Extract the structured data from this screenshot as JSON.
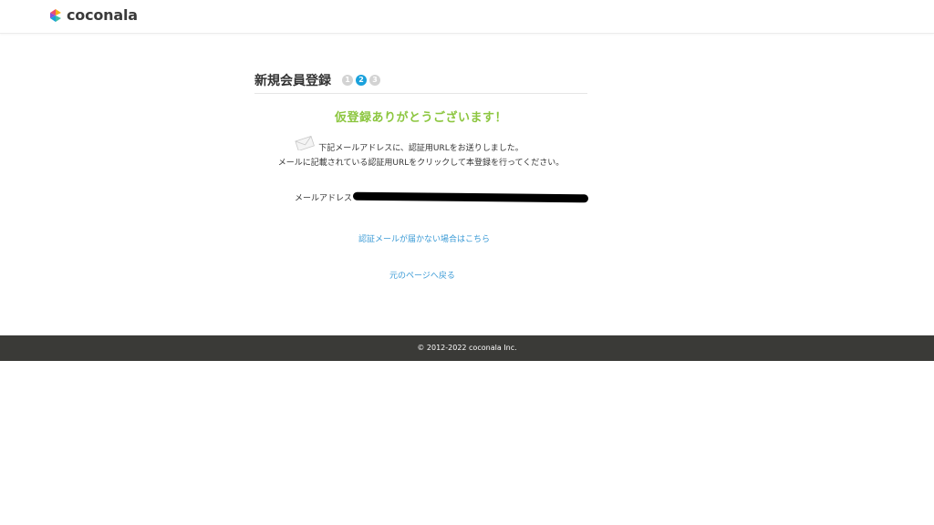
{
  "header": {
    "logo_text": "coconala"
  },
  "main": {
    "title": "新規会員登録",
    "steps": [
      "1",
      "2",
      "3"
    ],
    "active_step": 2,
    "success_message": "仮登録ありがとうございます！",
    "message_line1": "下記メールアドレスに、認証用URLをお送りしました。",
    "message_line2": "メールに記載されている認証用URLをクリックして本登録を行ってください。",
    "email_label": "メールアドレス",
    "resend_link": "認証メールが届かない場合はこちら",
    "back_link": "元のページへ戻る"
  },
  "footer": {
    "copyright": "© 2012-2022 coconala Inc."
  },
  "colors": {
    "accent_green": "#8cc63f",
    "step_active": "#1aa1dc",
    "link": "#3c9bd6",
    "footer_bg": "#3a3a37"
  }
}
